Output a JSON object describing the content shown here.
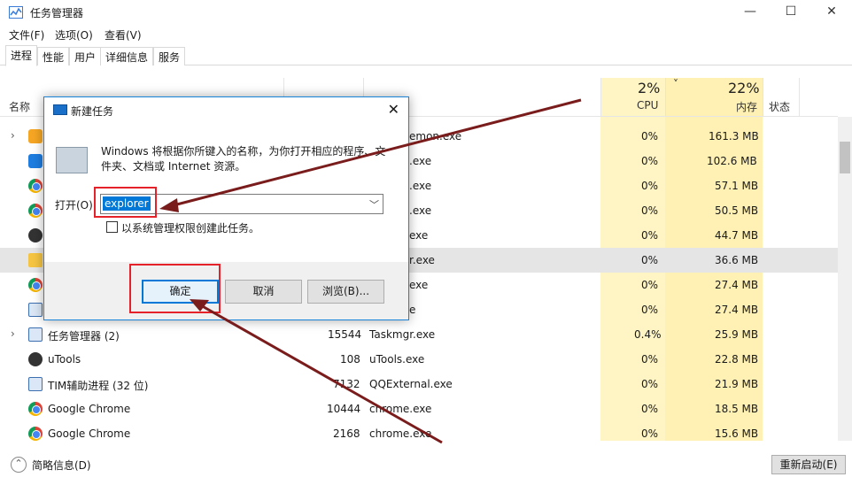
{
  "window": {
    "title": "任务管理器"
  },
  "window_controls": {
    "minimize": "—",
    "maximize": "☐",
    "close": "✕"
  },
  "menu": [
    "文件(F)",
    "选项(O)",
    "查看(V)"
  ],
  "tabs": [
    "进程",
    "性能",
    "用户",
    "详细信息",
    "服务"
  ],
  "header": {
    "name": "名称",
    "cpu_pct": "2%",
    "cpu": "CPU",
    "mem_pct": "22%",
    "mem": "内存",
    "status": "状态",
    "sort_indicator": "˅"
  },
  "rows": [
    {
      "name": "",
      "pid": "",
      "image": "emon.exe",
      "cpu": "0%",
      "mem": "161.3 MB"
    },
    {
      "name": "",
      "pid": "",
      "image": ".exe",
      "cpu": "0%",
      "mem": "102.6 MB"
    },
    {
      "name": "",
      "pid": "",
      "image": ".exe",
      "cpu": "0%",
      "mem": "57.1 MB"
    },
    {
      "name": "",
      "pid": "",
      "image": ".exe",
      "cpu": "0%",
      "mem": "50.5 MB"
    },
    {
      "name": "",
      "pid": "",
      "image": "exe",
      "cpu": "0%",
      "mem": "44.7 MB"
    },
    {
      "name": "",
      "pid": "",
      "image": "r.exe",
      "cpu": "0%",
      "mem": "36.6 MB"
    },
    {
      "name": "",
      "pid": "",
      "image": "exe",
      "cpu": "0%",
      "mem": "27.4 MB"
    },
    {
      "name": "",
      "pid": "",
      "image": "e",
      "cpu": "0%",
      "mem": "27.4 MB"
    },
    {
      "name": "任务管理器 (2)",
      "pid": "15544",
      "image": "Taskmgr.exe",
      "cpu": "0.4%",
      "mem": "25.9 MB"
    },
    {
      "name": "uTools",
      "pid": "108",
      "image": "uTools.exe",
      "cpu": "0%",
      "mem": "22.8 MB"
    },
    {
      "name": "TIM辅助进程 (32 位)",
      "pid": "7132",
      "image": "QQExternal.exe",
      "cpu": "0%",
      "mem": "21.9 MB"
    },
    {
      "name": "Google Chrome",
      "pid": "10444",
      "image": "chrome.exe",
      "cpu": "0%",
      "mem": "18.5 MB"
    },
    {
      "name": "Google Chrome",
      "pid": "2168",
      "image": "chrome.exe",
      "cpu": "0%",
      "mem": "15.6 MB"
    }
  ],
  "footer": {
    "less_details": "简略信息(D)",
    "less_details_icon": "⌃",
    "restart": "重新启动(E)"
  },
  "dialog": {
    "title": "新建任务",
    "close": "✕",
    "description": "Windows 将根据你所键入的名称，为你打开相应的程序、文件夹、文档或 Internet 资源。",
    "open_label": "打开(O):",
    "open_value": "explorer",
    "dropdown_arrow": "﹀",
    "admin_checkbox_label": "以系统管理权限创建此任务。",
    "ok": "确定",
    "cancel": "取消",
    "browse": "浏览(B)..."
  },
  "colors": {
    "accent": "#0078d7",
    "annotation_red": "#e5222a",
    "arrow": "#7a1c1c",
    "cpu_col": "#fff4c4",
    "mem_col": "#fff0b3"
  }
}
